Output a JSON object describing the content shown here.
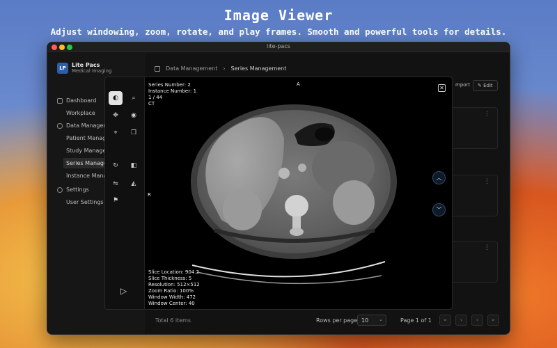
{
  "hero": {
    "title": "Image Viewer",
    "subtitle": "Adjust windowing, zoom, rotate, and play frames. Smooth and powerful tools for details."
  },
  "window": {
    "title": "lite-pacs"
  },
  "brand": {
    "logo_text": "LP",
    "name": "Lite Pacs",
    "subtitle": "Medical Imaging"
  },
  "sidebar": {
    "items": [
      {
        "label": "Dashboard",
        "icon": "grid-icon"
      },
      {
        "label": "Workplace"
      },
      {
        "label": "Data Manageme",
        "icon": "database-icon"
      },
      {
        "label": "Patient Manage"
      },
      {
        "label": "Study Managem"
      },
      {
        "label": "Series Managen"
      },
      {
        "label": "Instance Manag"
      },
      {
        "label": "Settings",
        "icon": "gear-icon"
      },
      {
        "label": "User Settings"
      }
    ]
  },
  "breadcrumb": {
    "parent": "Data Management",
    "separator": "›",
    "current": "Series Management"
  },
  "toolbar": {
    "import_label": "mport",
    "edit_label": "Edit"
  },
  "cards": {
    "menu_glyph": "⋮"
  },
  "footer": {
    "total": "Total 6 items",
    "rows_per_page_label": "Rows per page",
    "rows_per_page_value": "10",
    "page_label": "Page 1 of 1",
    "first": "«",
    "prev": "‹",
    "next": "›",
    "last": "»"
  },
  "viewer": {
    "top_left": [
      "Series Number: 2",
      "Instance Number: 1",
      "1 / 44",
      "CT"
    ],
    "orientation_top": "A",
    "orientation_left": "R",
    "bottom_left": [
      "Slice Location: 904.2",
      "Slice Thickness: 5",
      "Resolution: 512×512",
      "Zoom Ratio: 100%",
      "Window Width: 472",
      "Window Center: 40"
    ],
    "close_glyph": "✕",
    "prev_glyph": "︿",
    "next_glyph": "﹀"
  },
  "tools": [
    {
      "name": "window-level-icon",
      "glyph": "◐",
      "active": true
    },
    {
      "name": "zoom-icon",
      "glyph": "⌕"
    },
    {
      "name": "pan-icon",
      "glyph": "✥"
    },
    {
      "name": "magnify-icon",
      "glyph": "◉"
    },
    {
      "name": "crosshair-icon",
      "glyph": "⌖"
    },
    {
      "name": "copy-icon",
      "glyph": "❐"
    },
    {
      "name": "rotate-icon",
      "glyph": "↻"
    },
    {
      "name": "invert-icon",
      "glyph": "◧"
    },
    {
      "name": "flip-horizontal-icon",
      "glyph": "⇋"
    },
    {
      "name": "flip-vertical-icon",
      "glyph": "◭"
    },
    {
      "name": "reset-icon",
      "glyph": "⚑"
    }
  ],
  "play_glyph": "▷"
}
